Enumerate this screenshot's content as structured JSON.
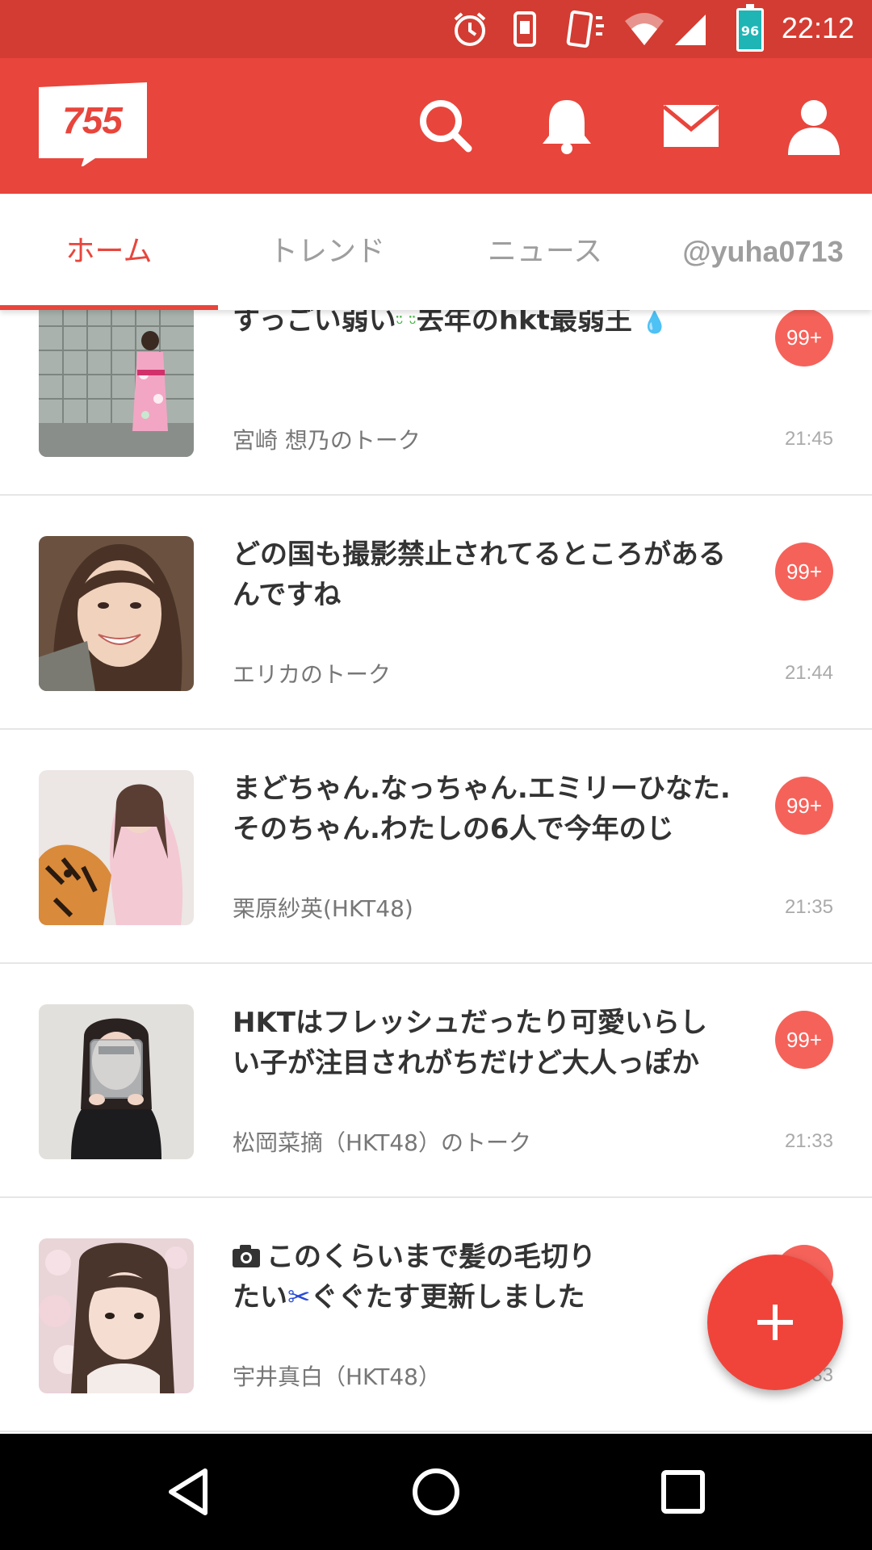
{
  "status_bar": {
    "time": "22:12",
    "battery_level": "96",
    "icons": [
      "alarm-icon",
      "vibrate-icon",
      "rotation-icon",
      "wifi-icon",
      "signal-icon",
      "battery-icon"
    ]
  },
  "app_bar": {
    "logo_text": "755",
    "icons": [
      "search-icon",
      "bell-icon",
      "mail-icon",
      "profile-icon"
    ]
  },
  "tabs": [
    {
      "label": "ホーム",
      "active": true
    },
    {
      "label": "トレンド",
      "active": false
    },
    {
      "label": "ニュース",
      "active": false
    },
    {
      "label": "@yuha0713",
      "active": false
    }
  ],
  "feed": [
    {
      "title_before": "すっごい弱い",
      "title_emoji": "ᵕ̈ ᵕ̈",
      "title_after": "去年のhkt最弱王",
      "title_end_emoji": "💧",
      "source": "宮崎 想乃のトーク",
      "time": "21:45",
      "badge": "99+"
    },
    {
      "title": "どの国も撮影禁止されてるところがあるんですね",
      "source": "エリカのトーク",
      "time": "21:44",
      "badge": "99+"
    },
    {
      "title": "まどちゃん.なっちゃん.エミリーひなた.そのちゃん.わたしの6人で今年のじ",
      "source": "栗原紗英(HKT48)",
      "time": "21:35",
      "badge": "99+"
    },
    {
      "title": "HKTはフレッシュだったり可愛いらしい子が注目されがちだけど大人っぽか",
      "source": "松岡菜摘（HKT48）のトーク",
      "time": "21:33",
      "badge": "99+"
    },
    {
      "title_line1": "このくらいまで髪の毛切り",
      "title_line2_before": "たい",
      "title_emoji": "✂",
      "title_line2_after": "ぐぐたす更新しました",
      "source": "宇井真白（HKT48）",
      "time": "21:33",
      "badge": "99+"
    }
  ],
  "fab": {
    "icon": "plus-icon"
  },
  "nav_bar": {
    "buttons": [
      "back-icon",
      "home-icon",
      "recents-icon"
    ]
  },
  "colors": {
    "brand": "#e8453c",
    "status_bar": "#d33c32",
    "badge": "#f5625a"
  }
}
